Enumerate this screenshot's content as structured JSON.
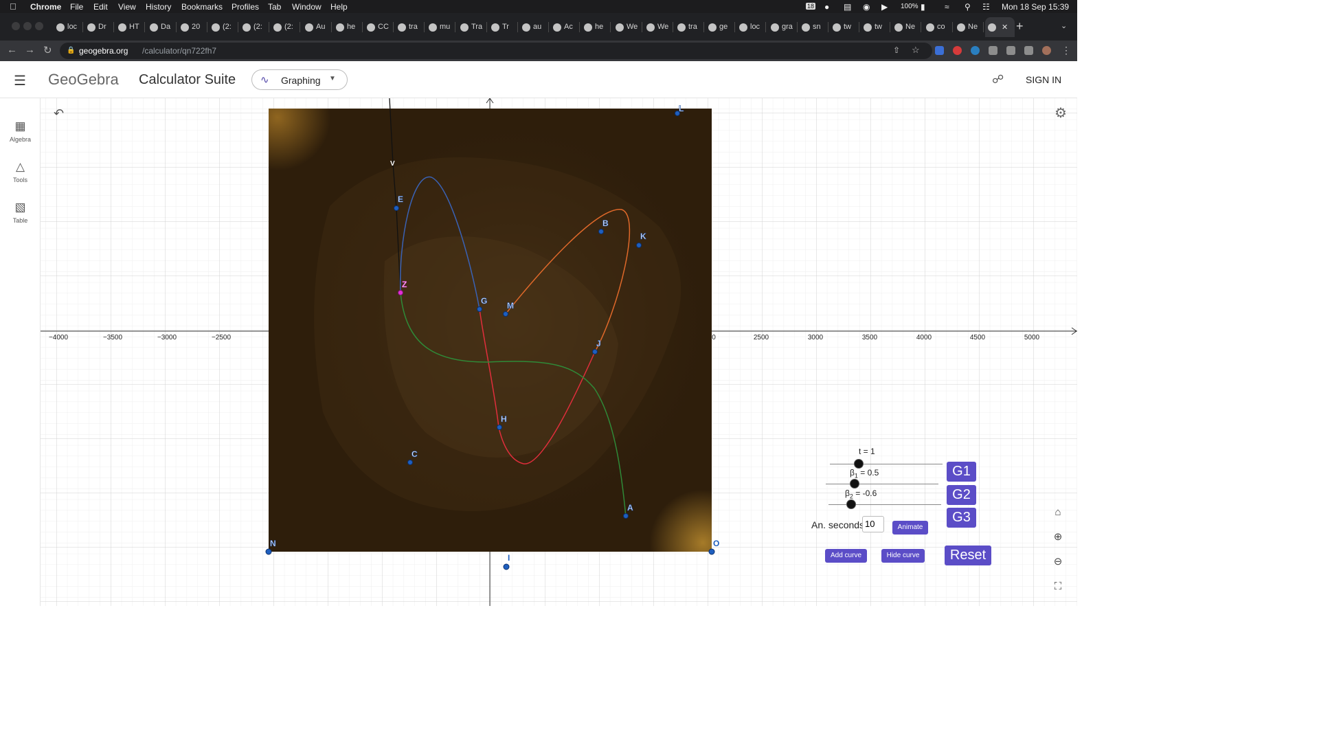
{
  "menubar": {
    "apple": "",
    "app": "Chrome",
    "items": [
      "File",
      "Edit",
      "View",
      "History",
      "Bookmarks",
      "Profiles",
      "Tab",
      "Window",
      "Help"
    ],
    "badge": "18",
    "battery": "100%",
    "datetime": "Mon 18 Sep  15:39"
  },
  "browser": {
    "tabs": [
      "loc",
      "Dr",
      "HT",
      "Da",
      "20",
      "(2:",
      "(2:",
      "(2:",
      "Au",
      "he",
      "CC",
      "tra",
      "mu",
      "Tra",
      "Tr",
      "au",
      "Ac",
      "he",
      "We",
      "We",
      "tra",
      "ge",
      "loc",
      "gra",
      "sn",
      "tw",
      "tw",
      "Ne",
      "co",
      "Ne",
      ""
    ],
    "active_tab_index": 30,
    "close_glyph": "✕",
    "new_tab_glyph": "+",
    "url_host": "geogebra.org",
    "url_path": "/calculator/qn722fh7"
  },
  "header": {
    "logo": "GeoGebra",
    "suite_title": "Calculator Suite",
    "app_selector": "Graphing",
    "signin": "SIGN IN"
  },
  "sidebar": {
    "items": [
      {
        "label": "Algebra",
        "icon": "calculator-icon"
      },
      {
        "label": "Tools",
        "icon": "shapes-icon"
      },
      {
        "label": "Table",
        "icon": "table-icon"
      }
    ]
  },
  "graph": {
    "x_ticks": [
      "−4000",
      "−3500",
      "−3000",
      "−2500",
      "0",
      "2500",
      "3000",
      "3500",
      "4000",
      "4500",
      "5000"
    ],
    "point_labels": [
      "L",
      "V",
      "E",
      "B",
      "K",
      "Z",
      "G",
      "M",
      "J",
      "H",
      "C",
      "A",
      "N",
      "O",
      "I"
    ],
    "curve_colors": {
      "blue": "#3a62b5",
      "orange": "#e0692a",
      "red": "#e12e3c",
      "green": "#2f8a38",
      "black": "#111111"
    },
    "background_image": "dark-brown-noise-texture"
  },
  "controls": {
    "t_label": "t = 1",
    "t_value": 1,
    "beta1_prefix": "β",
    "beta1_sub": "1",
    "beta1_value": "= 0.5",
    "beta2_prefix": "β",
    "beta2_sub": "2",
    "beta2_value": "= -0.6",
    "an_seconds_label": "An. seconds",
    "an_seconds_value": "10",
    "animate": "Animate",
    "add_curve": "Add curve",
    "hide_curve": "Hide curve",
    "reset": "Reset",
    "g1": "G1",
    "g2": "G2",
    "g3": "G3"
  },
  "accent_color": "#5b4dc7"
}
